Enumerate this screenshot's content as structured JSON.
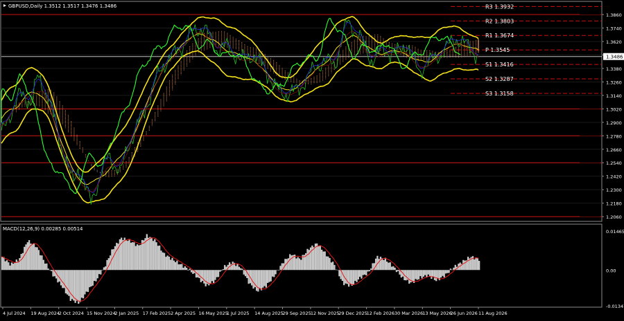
{
  "main": {
    "title": "GBPUSD,Daily  1.3512 1.3517 1.3476 1.3486",
    "current_price": "1.3486",
    "y_ticks": [
      "1.3860",
      "1.3740",
      "1.3620",
      "1.3500",
      "1.3380",
      "1.3260",
      "1.3140",
      "1.3020",
      "1.2900",
      "1.2780",
      "1.2660",
      "1.2540",
      "1.2420",
      "1.2300",
      "1.2180",
      "1.2060"
    ],
    "ylim": [
      1.203,
      1.3965
    ]
  },
  "pivots": [
    {
      "label": "R3",
      "value": "1.3932"
    },
    {
      "label": "R2",
      "value": "1.3803"
    },
    {
      "label": "R1",
      "value": "1.3674"
    },
    {
      "label": "P",
      "value": "1.3545"
    },
    {
      "label": "S1",
      "value": "1.3416"
    },
    {
      "label": "S2",
      "value": "1.3287"
    },
    {
      "label": "S3",
      "value": "1.3158"
    }
  ],
  "macd": {
    "title": "MACD(12,26,9) 0.00285 0.00514",
    "y_ticks": [
      "0.01465",
      "0.00",
      "-0.01347"
    ]
  },
  "x_labels": [
    "4 Jul 2024",
    "19 Aug 2024",
    "2 Oct 2024",
    "15 Nov 2024",
    "2 Jan 2025",
    "17 Feb 2025",
    "2 Apr 2025",
    "16 May 2025",
    "1 Jul 2025",
    "14 Aug 2025",
    "29 Sep 2025",
    "12 Nov 2025",
    "29 Dec 2025",
    "12 Feb 2026",
    "30 Mar 2026",
    "13 May 2026",
    "26 Jun 2026",
    "11 Aug 2026"
  ],
  "chart_data": [
    {
      "type": "line",
      "title": "GBPUSD,Daily",
      "approx_close_path": [
        [
          0,
          1.279
        ],
        [
          3,
          1.315
        ],
        [
          5,
          1.308
        ],
        [
          6,
          1.33
        ],
        [
          8,
          1.312
        ],
        [
          10,
          1.268
        ],
        [
          11,
          1.255
        ],
        [
          12,
          1.235
        ],
        [
          13,
          1.25
        ],
        [
          15,
          1.218
        ],
        [
          17,
          1.248
        ],
        [
          18,
          1.26
        ],
        [
          20,
          1.245
        ],
        [
          21,
          1.265
        ],
        [
          23,
          1.29
        ],
        [
          24,
          1.299
        ],
        [
          26,
          1.33
        ],
        [
          28,
          1.347
        ],
        [
          30,
          1.355
        ],
        [
          32,
          1.37
        ],
        [
          34,
          1.375
        ],
        [
          36,
          1.355
        ],
        [
          38,
          1.358
        ],
        [
          40,
          1.345
        ],
        [
          42,
          1.35
        ],
        [
          44,
          1.34
        ],
        [
          46,
          1.32
        ],
        [
          48,
          1.315
        ],
        [
          50,
          1.32
        ],
        [
          52,
          1.335
        ],
        [
          54,
          1.345
        ],
        [
          56,
          1.342
        ],
        [
          58,
          1.38
        ],
        [
          60,
          1.368
        ],
        [
          62,
          1.345
        ],
        [
          64,
          1.355
        ],
        [
          66,
          1.35
        ],
        [
          68,
          1.36
        ],
        [
          70,
          1.335
        ],
        [
          72,
          1.345
        ],
        [
          74,
          1.352
        ],
        [
          76,
          1.365
        ],
        [
          78,
          1.359
        ],
        [
          80,
          1.3486
        ]
      ],
      "horizontal_levels": [
        1.3932,
        1.3803,
        1.3674,
        1.3545,
        1.3416,
        1.3287,
        1.3158,
        1.386,
        1.302,
        1.278,
        1.254,
        1.206
      ],
      "ylim": [
        1.203,
        1.3965
      ]
    },
    {
      "type": "bar",
      "title": "MACD(12,26,9)",
      "values": [
        0.005,
        0.002,
        0.004,
        0.011,
        0.009,
        0.003,
        -0.002,
        -0.006,
        -0.011,
        -0.0125,
        -0.008,
        -0.004,
        0.001,
        0.008,
        0.012,
        0.011,
        0.009,
        0.013,
        0.011,
        0.006,
        0.004,
        0.002,
        0.0,
        -0.003,
        -0.006,
        -0.004,
        0.001,
        0.003,
        0.001,
        -0.005,
        -0.008,
        -0.006,
        -0.002,
        0.003,
        0.006,
        0.004,
        0.008,
        0.01,
        0.006,
        0.002,
        -0.005,
        -0.006,
        -0.003,
        -0.001,
        0.005,
        0.004,
        0.001,
        -0.003,
        -0.005,
        -0.003,
        -0.002,
        -0.004,
        -0.002,
        0.001,
        0.003,
        0.005,
        0.004
      ],
      "ylim": [
        -0.01347,
        0.01465
      ]
    }
  ]
}
